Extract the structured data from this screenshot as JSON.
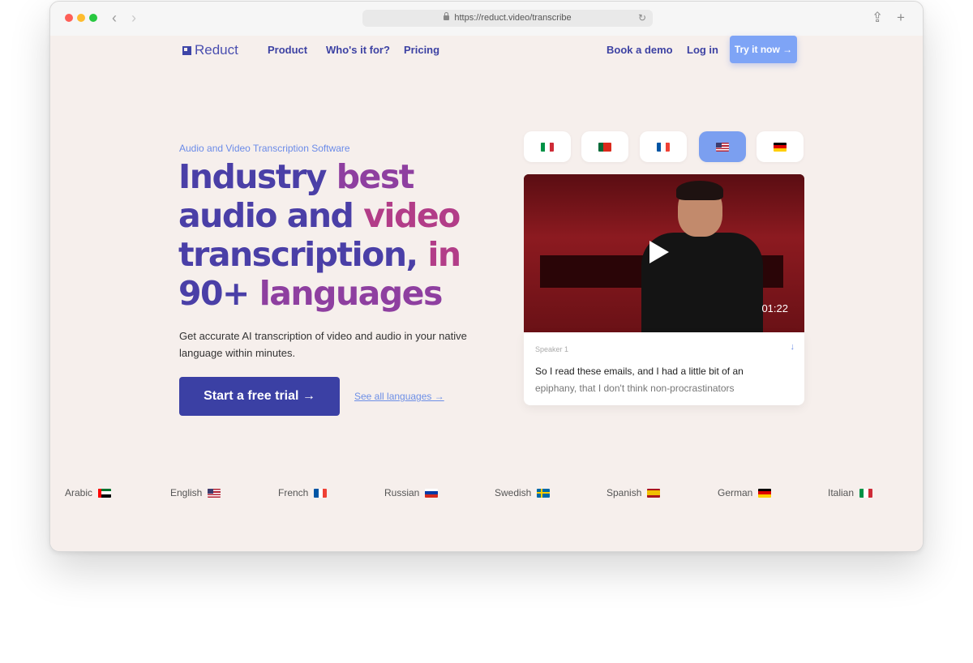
{
  "browser": {
    "url": "https://reduct.video/transcribe"
  },
  "nav": {
    "logo": "Reduct",
    "product": "Product",
    "whos_it_for": "Who's it for?",
    "pricing": "Pricing",
    "book_demo": "Book a demo",
    "login": "Log in",
    "try_now": "Try it now →"
  },
  "hero": {
    "eyebrow": "Audio and Video Transcription Software",
    "headline": [
      [
        "Industry ",
        "best"
      ],
      [
        "audio and ",
        "video"
      ],
      [
        "transcription, ",
        "in"
      ],
      [
        "90+ ",
        "languages"
      ]
    ],
    "subtitle": "Get accurate AI transcription of video and audio in your native language within minutes.",
    "cta": "Start a free trial →",
    "see_all": "See all languages →"
  },
  "language_switcher": {
    "flags": [
      "italy",
      "portugal",
      "france",
      "usa",
      "germany"
    ],
    "active": "usa"
  },
  "video": {
    "duration": "01:22"
  },
  "transcript": {
    "speaker": "Speaker 1",
    "line1": "So I read these emails, and I had a little bit of an",
    "line2": "epiphany, that I don't think non-procrastinators"
  },
  "languages": [
    {
      "name": "Arabic",
      "flag": "uae"
    },
    {
      "name": "English",
      "flag": "usa"
    },
    {
      "name": "French",
      "flag": "france"
    },
    {
      "name": "Russian",
      "flag": "russia"
    },
    {
      "name": "Swedish",
      "flag": "sweden"
    },
    {
      "name": "Spanish",
      "flag": "spain"
    },
    {
      "name": "German",
      "flag": "germany"
    },
    {
      "name": "Italian",
      "flag": "italy"
    }
  ],
  "colors": {
    "brand": "#3b40a4",
    "accent": "#7ea4f6",
    "page_bg": "#f6efec"
  }
}
